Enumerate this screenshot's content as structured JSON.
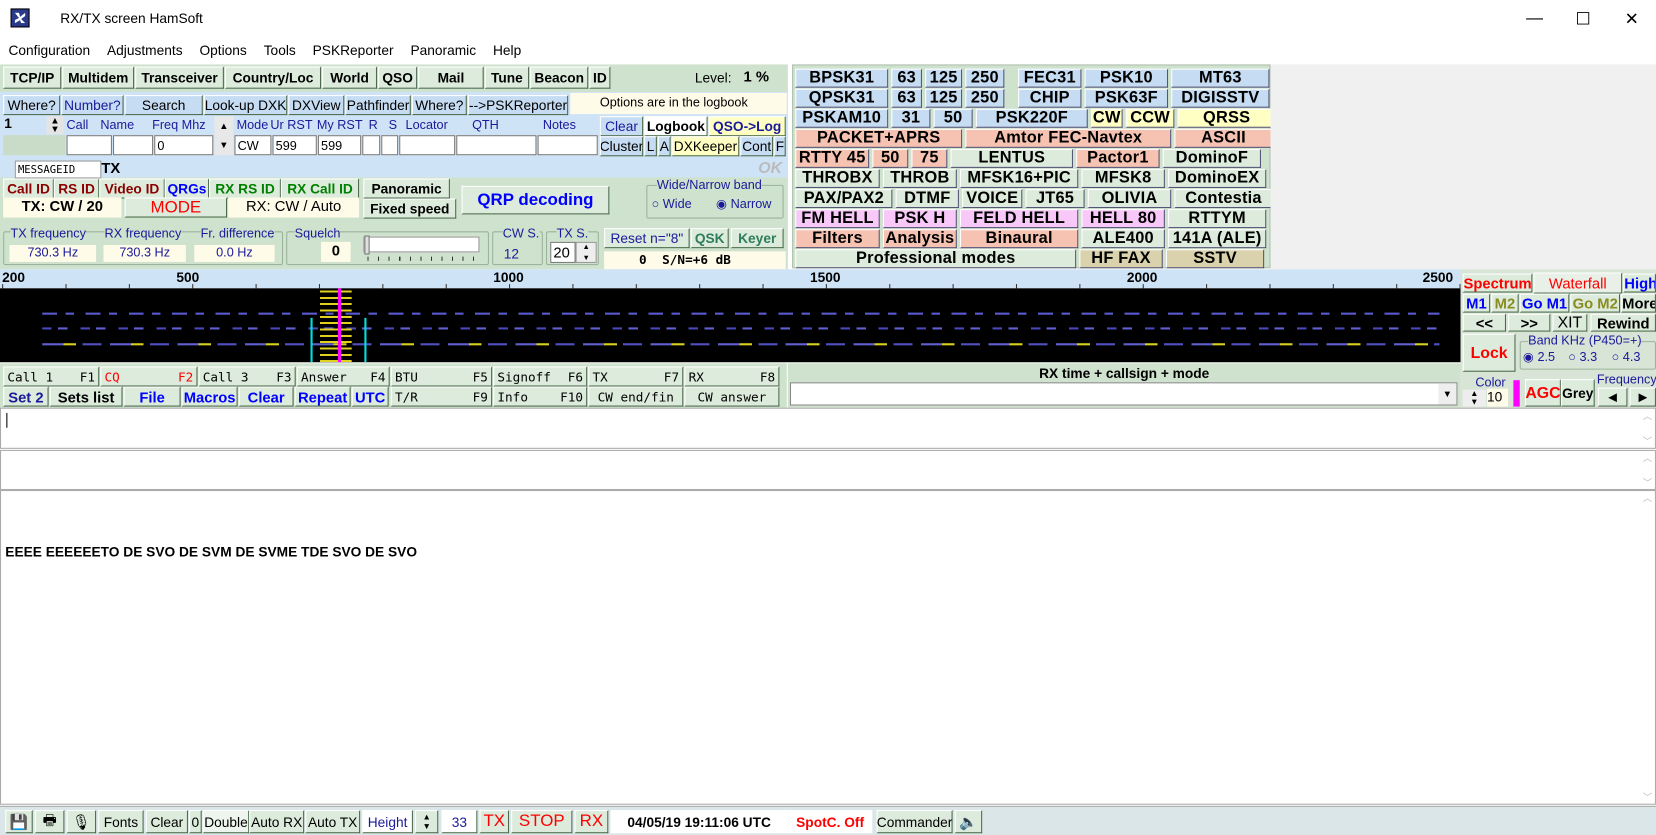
{
  "window": {
    "title": "RX/TX screen  HamSoft",
    "minimize": "—",
    "maximize": "☐",
    "close": "✕"
  },
  "menu": [
    "Configuration",
    "Adjustments",
    "Options",
    "Tools",
    "PSKReporter",
    "Panoramic",
    "Help"
  ],
  "toolbar": {
    "buttons": [
      "TCP/IP",
      "Multidem",
      "Transceiver",
      "Country/Loc",
      "World",
      "QSO",
      "Mail",
      "Tune",
      "Beacon",
      "ID"
    ],
    "level_label": "Level:",
    "level_value": "1 %"
  },
  "lookup": {
    "buttons": [
      "Where?",
      "Number?",
      "Search",
      "Look-up DXK",
      "DXView",
      "Pathfinder",
      "Where?",
      "-->PSKReporter"
    ],
    "options_note": "Options are in the logbook"
  },
  "log": {
    "index": "1",
    "headers": [
      "Call",
      "Name",
      "Freq Mhz",
      "Mode",
      "Ur RST",
      "My RST",
      "R",
      "S",
      "Locator",
      "QTH",
      "Notes"
    ],
    "freq": "0",
    "mode": "CW",
    "ur_rst": "599",
    "my_rst": "599",
    "clear": "Clear",
    "logbook": "Logbook",
    "qso_log": "QSO->Log",
    "cluster": "Cluster",
    "l": "L",
    "a": "A",
    "dxkeeper": "DXKeeper",
    "cont": "Cont",
    "f": "F"
  },
  "tabs": {
    "messageid": "MESSAGEID",
    "tx": "TX",
    "ok": "OK"
  },
  "ids": {
    "call_id": "Call ID",
    "rs_id": "RS ID",
    "video_id": "Video ID",
    "qrgs": "QRGs",
    "rx_rs_id": "RX RS ID",
    "rx_call_id": "RX Call ID",
    "panoramic": "Panoramic",
    "fixed_speed": "Fixed speed",
    "qrp": "QRP decoding",
    "tx_mode": "TX: CW / 20",
    "mode": "MODE",
    "rx_mode": "RX: CW / Auto"
  },
  "band": {
    "title": "Wide/Narrow band",
    "wide": "Wide",
    "narrow": "Narrow",
    "selected": "Narrow"
  },
  "freq": {
    "tx_label": "TX frequency",
    "tx": "730.3 Hz",
    "rx_label": "RX frequency",
    "rx": "730.3 Hz",
    "diff_label": "Fr. difference",
    "diff": "0.0 Hz",
    "squelch_label": "Squelch",
    "squelch": "0",
    "cws_label": "CW S.",
    "cws": "12",
    "txs_label": "TX S.",
    "txs": "20",
    "reset": "Reset n=\"8\"",
    "qsk": "QSK",
    "keyer": "Keyer",
    "count": "0",
    "snr": "S/N=+6 dB"
  },
  "modes": [
    [
      {
        "l": "BPSK31",
        "c": "b"
      },
      {
        "l": "63",
        "c": "b"
      },
      {
        "l": "125",
        "c": "b"
      },
      {
        "l": "250",
        "c": "b"
      },
      {
        "l": "FEC31",
        "c": "b"
      },
      {
        "l": "PSK10",
        "c": "b"
      },
      {
        "l": "MT63",
        "c": "b"
      }
    ],
    [
      {
        "l": "QPSK31",
        "c": "b"
      },
      {
        "l": "63",
        "c": "b"
      },
      {
        "l": "125",
        "c": "b"
      },
      {
        "l": "250",
        "c": "b"
      },
      {
        "l": "CHIP",
        "c": "b"
      },
      {
        "l": "PSK63F",
        "c": "b"
      },
      {
        "l": "DIGISSTV",
        "c": "b"
      }
    ],
    [
      {
        "l": "PSKAM10",
        "c": "b"
      },
      {
        "l": "31",
        "c": "b"
      },
      {
        "l": "50",
        "c": "b"
      },
      {
        "l": "PSK220F",
        "c": "b"
      },
      {
        "l": "CW",
        "c": "y"
      },
      {
        "l": "CCW",
        "c": "y"
      },
      {
        "l": "QRSS",
        "c": "y"
      }
    ],
    [
      {
        "l": "PACKET+APRS",
        "c": "s"
      },
      {
        "l": "Amtor FEC-Navtex",
        "c": "s"
      },
      {
        "l": "ASCII",
        "c": "s"
      }
    ],
    [
      {
        "l": "RTTY 45",
        "c": "s"
      },
      {
        "l": "50",
        "c": "s"
      },
      {
        "l": "75",
        "c": "s"
      },
      {
        "l": "LENTUS",
        "c": "g"
      },
      {
        "l": "Pactor1",
        "c": "s"
      },
      {
        "l": "DominoF",
        "c": "g"
      }
    ],
    [
      {
        "l": "THROBX",
        "c": "g"
      },
      {
        "l": "THROB",
        "c": "g"
      },
      {
        "l": "MFSK16+PIC",
        "c": "g"
      },
      {
        "l": "MFSK8",
        "c": "g"
      },
      {
        "l": "DominoEX",
        "c": "g"
      }
    ],
    [
      {
        "l": "PAX/PAX2",
        "c": "g"
      },
      {
        "l": "DTMF",
        "c": "g"
      },
      {
        "l": "VOICE",
        "c": "g"
      },
      {
        "l": "JT65",
        "c": "g"
      },
      {
        "l": "OLIVIA",
        "c": "g"
      },
      {
        "l": "Contestia",
        "c": "g"
      }
    ],
    [
      {
        "l": "FM HELL",
        "c": "p"
      },
      {
        "l": "PSK H",
        "c": "p"
      },
      {
        "l": "FELD HELL",
        "c": "p"
      },
      {
        "l": "HELL 80",
        "c": "p"
      },
      {
        "l": "RTTYM",
        "c": "g"
      }
    ],
    [
      {
        "l": "Filters",
        "c": "s"
      },
      {
        "l": "Analysis",
        "c": "s"
      },
      {
        "l": "Binaural",
        "c": "s"
      },
      {
        "l": "ALE400",
        "c": "g"
      },
      {
        "l": "141A (ALE)",
        "c": "g"
      }
    ],
    [
      {
        "l": "Professional modes",
        "c": "g"
      },
      {
        "l": "HF FAX",
        "c": "t"
      },
      {
        "l": "SSTV",
        "c": "t"
      }
    ]
  ],
  "ruler": {
    "ticks": [
      "200",
      "500",
      "1000",
      "1500",
      "2000",
      "2500"
    ]
  },
  "macros": {
    "row1": [
      {
        "l": "Call 1",
        "k": "F1"
      },
      {
        "l": "CQ",
        "k": "F2"
      },
      {
        "l": "Call 3",
        "k": "F3"
      },
      {
        "l": "Answer",
        "k": "F4"
      },
      {
        "l": "BTU",
        "k": "F5"
      },
      {
        "l": "Signoff",
        "k": "F6"
      },
      {
        "l": "TX",
        "k": "F7"
      },
      {
        "l": "RX",
        "k": "F8"
      }
    ],
    "row2": [
      "Set 2",
      "Sets list",
      "File",
      "Macros",
      "Clear",
      "Repeat",
      "UTC"
    ],
    "row3": [
      {
        "l": "T/R",
        "k": "F9"
      },
      {
        "l": "Info",
        "k": "F10"
      },
      {
        "l": "CW end/fin",
        "k": ""
      },
      {
        "l": "CW answer",
        "k": ""
      }
    ]
  },
  "rx_header": "RX time + callsign + mode",
  "right": {
    "spectrum": "Spectrum",
    "waterfall": "Waterfall",
    "high": "High",
    "m1": "M1",
    "m2": "M2",
    "go_m1": "Go M1",
    "go_m2": "Go M2",
    "more": "More",
    "prev": "<<",
    "next": ">>",
    "xit": "XIT",
    "rewind": "Rewind",
    "lock": "Lock",
    "band_label": "Band KHz (P450=+)",
    "band_options": [
      "2.5",
      "3.3",
      "4.3"
    ],
    "band_selected": "2.5",
    "color_label": "Color",
    "color_value": "10",
    "agc": "AGC",
    "grey": "Grey",
    "freq_label": "Frequency"
  },
  "rx_text": "EEEE EEEEEETO DE SVO DE SVM DE SVME TDE SVO DE SVO",
  "status": {
    "fonts": "Fonts",
    "clear": "Clear",
    "zero": "0",
    "double": "Double",
    "auto_rx": "Auto RX",
    "auto_tx": "Auto TX",
    "height": "Height",
    "height_value": "33",
    "tx": "TX",
    "stop": "STOP",
    "rx": "RX",
    "datetime": "04/05/19 19:11:06 UTC",
    "spotc": "SpotC. Off",
    "commander": "Commander"
  },
  "colors": {
    "panel": "#cfe2cd",
    "accent_red": "#ff0000",
    "accent_blue": "#0000ff",
    "waterfall_marker": "#ff00ff"
  }
}
